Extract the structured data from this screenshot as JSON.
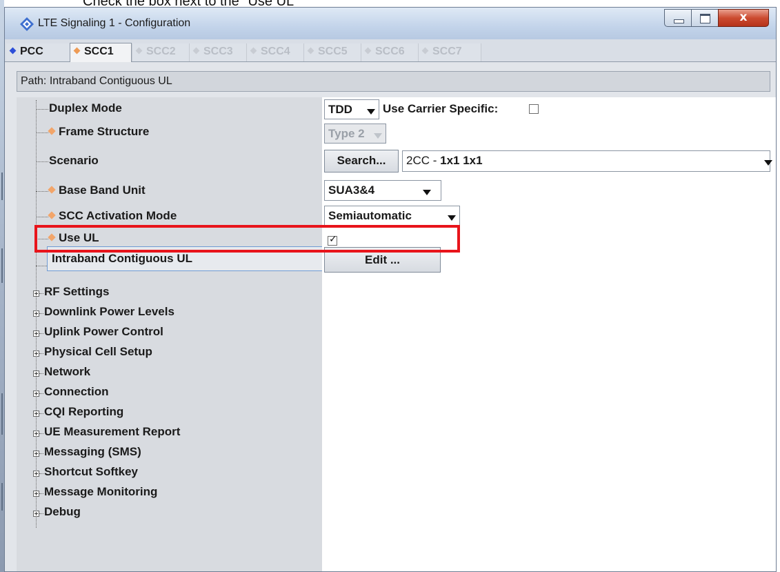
{
  "caption": "Check the box next to the \"Use UL\"",
  "window": {
    "title": "LTE Signaling 1 - Configuration",
    "close_glyph": "x"
  },
  "tabs": [
    "PCC",
    "SCC1",
    "SCC2",
    "SCC3",
    "SCC4",
    "SCC5",
    "SCC6",
    "SCC7"
  ],
  "active_tab": "SCC1",
  "path": {
    "label": "Path:",
    "value": "Intraband Contiguous UL"
  },
  "rows": {
    "duplex_mode": {
      "label": "Duplex Mode",
      "value": "TDD",
      "extra_label": "Use Carrier Specific:",
      "extra_checked": false
    },
    "frame_structure": {
      "label": "Frame Structure",
      "value": "Type 2"
    },
    "scenario": {
      "label": "Scenario",
      "button": "Search...",
      "value_prefix": "2CC - ",
      "value_bold": "1x1 1x1"
    },
    "base_band_unit": {
      "label": "Base Band Unit",
      "value": "SUA3&4"
    },
    "scc_activation_mode": {
      "label": "SCC Activation Mode",
      "value": "Semiautomatic"
    },
    "use_ul": {
      "label": "Use UL",
      "checked": true,
      "check_glyph": "✓"
    },
    "intraband": {
      "label": "Intraband Contiguous UL",
      "button": "Edit ..."
    }
  },
  "nodes": [
    "RF Settings",
    "Downlink Power Levels",
    "Uplink Power Control",
    "Physical Cell Setup",
    "Network",
    "Connection",
    "CQI Reporting",
    "UE Measurement Report",
    "Messaging (SMS)",
    "Shortcut Softkey",
    "Message Monitoring",
    "Debug"
  ],
  "colors": {
    "highlight": "#e8141b",
    "pcc_diamond": "#2d4fd8",
    "orange_diamond": "#f2a56a"
  }
}
